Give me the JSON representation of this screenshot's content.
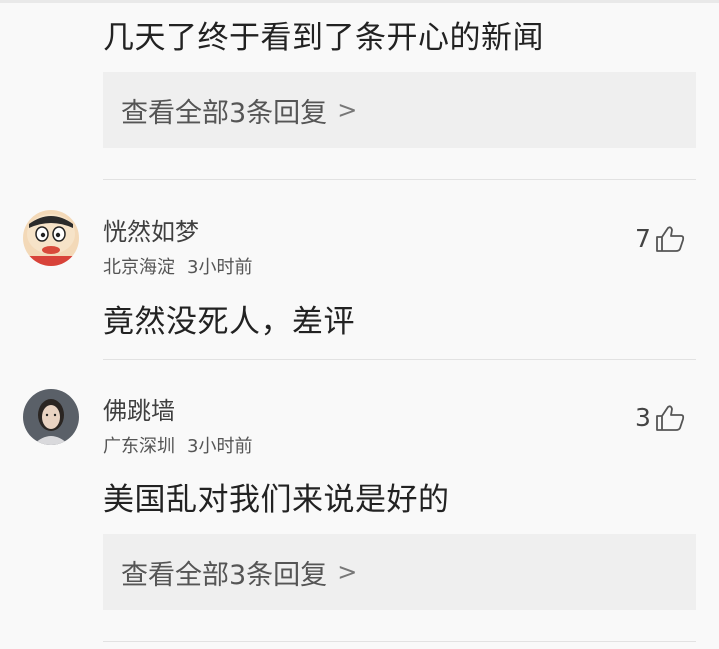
{
  "top_comment": {
    "text": "几天了终于看到了条开心的新闻",
    "replies_label": "查看全部3条回复"
  },
  "comments": [
    {
      "username": "恍然如梦",
      "location": "北京海淀",
      "time": "3小时前",
      "likes": "7",
      "text": "竟然没死人，差评"
    },
    {
      "username": "佛跳墙",
      "location": "广东深圳",
      "time": "3小时前",
      "likes": "3",
      "text": "美国乱对我们来说是好的",
      "replies_label": "查看全部3条回复"
    }
  ],
  "icons": {
    "like": "thumbs-up-icon",
    "chevron": "chevron-right-icon"
  },
  "colors": {
    "background": "#f9f9f9",
    "reply_box": "#efefef",
    "text": "#222222"
  }
}
